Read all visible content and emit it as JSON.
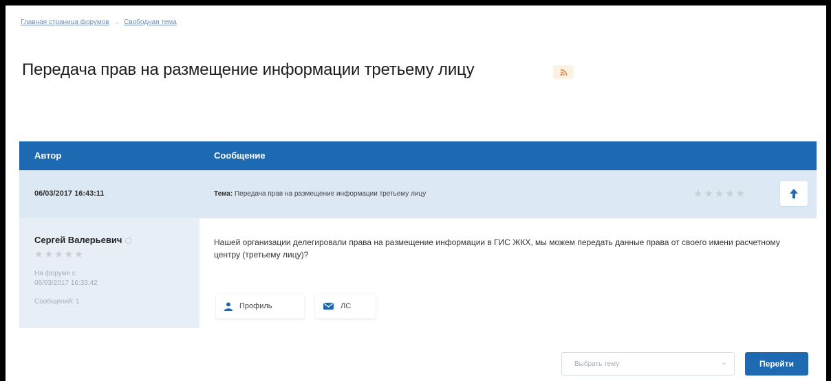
{
  "breadcrumb": {
    "items": [
      "Главная страница форумов",
      "Свободная тема"
    ],
    "separator": "→"
  },
  "page": {
    "title": "Передача прав на размещение информации третьему лицу"
  },
  "table": {
    "headers": {
      "author": "Автор",
      "message": "Сообщение"
    },
    "meta": {
      "date": "06/03/2017 16:43:11",
      "subject_label": "Тема:",
      "subject": "Передача прав на размещение информации третьему лицу",
      "rating": "★★★★★"
    },
    "post": {
      "author": "Сергей Валерьевич",
      "rating": "★★★★★",
      "since_label": "На форуме с",
      "since_date": "06/03/2017 16:33:42",
      "messages": "Сообщений: 1",
      "text": "Нашей организации делегировали права на размещение информации в ГИС ЖКХ, мы можем передать данные права от своего имени расчетному центру (третьему лицу)?",
      "profile_label": "Профиль",
      "pm_label": "ЛС"
    }
  },
  "footer": {
    "select_placeholder": "Выбрать тему",
    "go_label": "Перейти"
  },
  "colors": {
    "accent": "#1d6ab2",
    "meta_row": "#dce9f5",
    "author_col": "#e7eef5",
    "rss": "#f0822a"
  }
}
